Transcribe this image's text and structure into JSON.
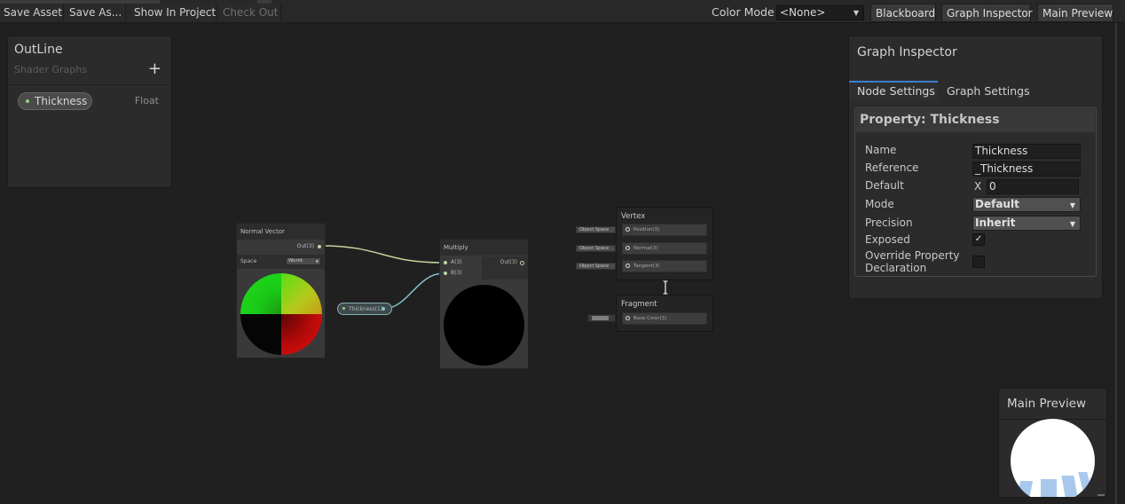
{
  "toolbar": {
    "save_asset": "Save Asset",
    "save_as": "Save As...",
    "show_in_project": "Show In Project",
    "check_out": "Check Out",
    "color_mode_label": "Color Mode",
    "color_mode_value": "<None>",
    "blackboard": "Blackboard",
    "graph_inspector": "Graph Inspector",
    "main_preview": "Main Preview"
  },
  "blackboard": {
    "title": "OutLine",
    "subtitle": "Shader Graphs",
    "add_symbol": "+",
    "property": {
      "name": "Thickness",
      "type": "Float"
    }
  },
  "nodes": {
    "normal_vector": {
      "title": "Normal Vector",
      "output": "Out(3)",
      "space_label": "Space",
      "space_value": "World"
    },
    "multiply": {
      "title": "Multiply",
      "input_a": "A(3)",
      "input_b": "B(3)",
      "output": "Out(3)"
    },
    "thickness_property": {
      "label": "Thickness(1)"
    }
  },
  "master": {
    "vertex_title": "Vertex",
    "vertex_slots": [
      {
        "label": "Position(3)",
        "space": "Object Space"
      },
      {
        "label": "Normal(3)",
        "space": "Object Space"
      },
      {
        "label": "Tangent(3)",
        "space": "Object Space"
      }
    ],
    "fragment_title": "Fragment",
    "fragment_slots": [
      {
        "label": "Base Color(3)",
        "swatch_color": "#7f7f7f"
      }
    ]
  },
  "inspector": {
    "title": "Graph Inspector",
    "tabs": {
      "node_settings": "Node Settings",
      "graph_settings": "Graph Settings"
    },
    "property_header": "Property: Thickness",
    "fields": {
      "name_label": "Name",
      "name_value": "Thickness",
      "reference_label": "Reference",
      "reference_value": "_Thickness",
      "default_label": "Default",
      "default_axis": "X",
      "default_value": "0",
      "mode_label": "Mode",
      "mode_value": "Default",
      "precision_label": "Precision",
      "precision_value": "Inherit",
      "exposed_label": "Exposed",
      "exposed_check": "✓",
      "override_label_line1": "Override Property",
      "override_label_line2": "Declaration"
    }
  },
  "main_preview": {
    "title": "Main Preview"
  },
  "icons": {
    "dropdown": "▼",
    "check": "check-icon",
    "add": "plus-icon"
  },
  "colors": {
    "accent": "#3d7ed0",
    "wire_vector": "#c5d39a",
    "wire_float": "#84c5c9",
    "float_dot": "#8ad27b"
  }
}
